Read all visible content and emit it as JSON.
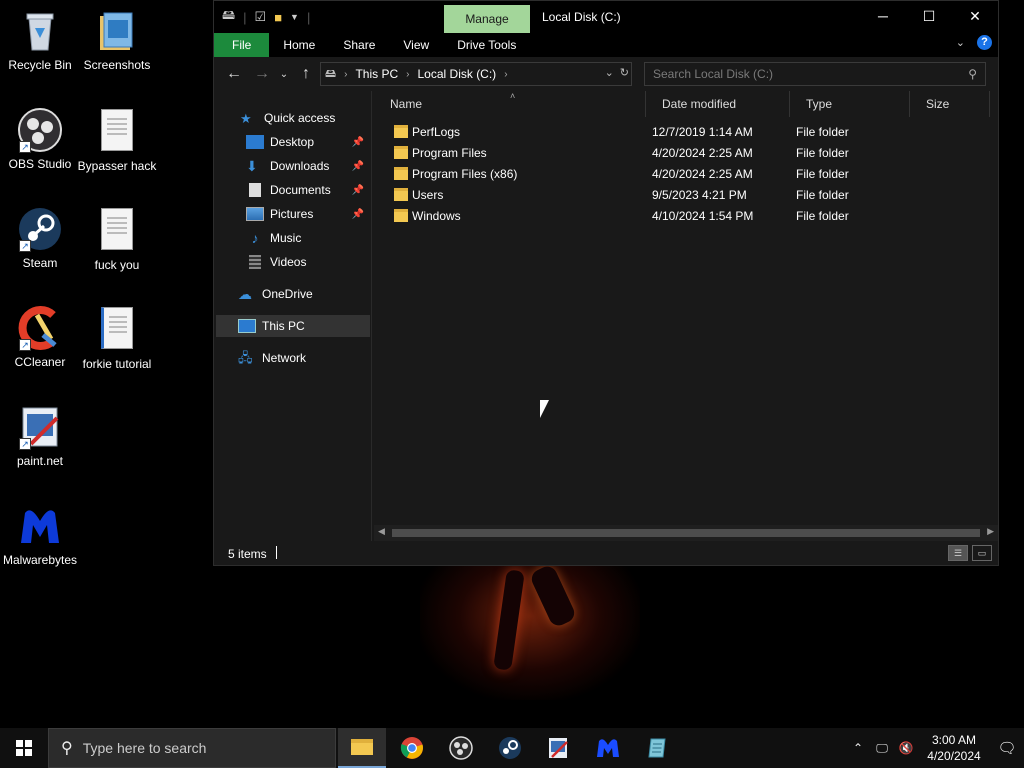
{
  "desktop": {
    "icons": [
      {
        "label": "Recycle Bin"
      },
      {
        "label": "Screenshots"
      },
      {
        "label": "OBS Studio"
      },
      {
        "label": "Bypasser hack"
      },
      {
        "label": "Steam"
      },
      {
        "label": "fuck you"
      },
      {
        "label": "CCleaner"
      },
      {
        "label": "forkie tutorial"
      },
      {
        "label": "paint.net"
      },
      {
        "label": "Malwarebytes"
      }
    ]
  },
  "window": {
    "title": "Local Disk (C:)",
    "context_tab": "Manage",
    "ribbon_tabs": [
      "File",
      "Home",
      "Share",
      "View",
      "Drive Tools"
    ],
    "address": {
      "crumbs": [
        "This PC",
        "Local Disk (C:)"
      ]
    },
    "search_placeholder": "Search Local Disk (C:)",
    "nav": {
      "quick_access": "Quick access",
      "items": [
        "Desktop",
        "Downloads",
        "Documents",
        "Pictures",
        "Music",
        "Videos"
      ],
      "onedrive": "OneDrive",
      "this_pc": "This PC",
      "network": "Network"
    },
    "columns": [
      "Name",
      "Date modified",
      "Type",
      "Size"
    ],
    "files": [
      {
        "name": "PerfLogs",
        "date": "12/7/2019 1:14 AM",
        "type": "File folder"
      },
      {
        "name": "Program Files",
        "date": "4/20/2024 2:25 AM",
        "type": "File folder"
      },
      {
        "name": "Program Files (x86)",
        "date": "4/20/2024 2:25 AM",
        "type": "File folder"
      },
      {
        "name": "Users",
        "date": "9/5/2023 4:21 PM",
        "type": "File folder"
      },
      {
        "name": "Windows",
        "date": "4/10/2024 1:54 PM",
        "type": "File folder"
      }
    ],
    "status": {
      "count": "5 items"
    }
  },
  "taskbar": {
    "search_placeholder": "Type here to search",
    "time": "3:00 AM",
    "date": "4/20/2024"
  },
  "colors": {
    "file_tab": "#1c8a3c",
    "manage_tab": "#a3d69a",
    "window_bg": "#191919",
    "folder": "#f3c851"
  }
}
